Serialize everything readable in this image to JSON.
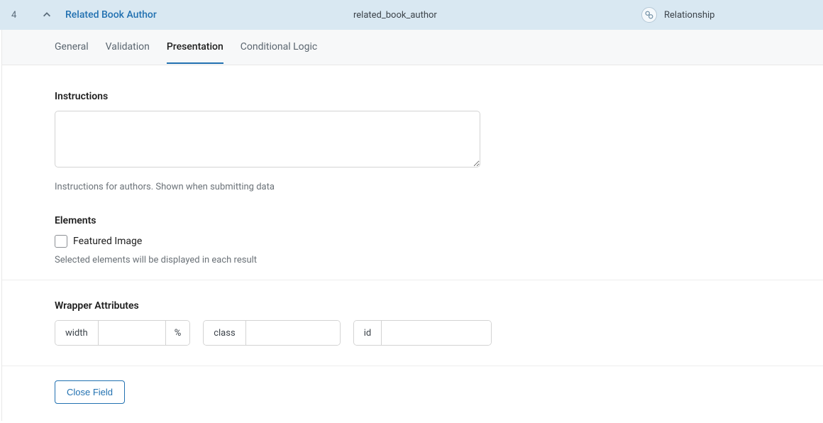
{
  "header": {
    "number": "4",
    "title": "Related Book Author",
    "slug": "related_book_author",
    "type": "Relationship"
  },
  "tabs": {
    "general": "General",
    "validation": "Validation",
    "presentation": "Presentation",
    "conditional": "Conditional Logic"
  },
  "instructions": {
    "label": "Instructions",
    "value": "",
    "help": "Instructions for authors. Shown when submitting data"
  },
  "elements": {
    "label": "Elements",
    "featured_image": "Featured Image",
    "help": "Selected elements will be displayed in each result"
  },
  "wrapper": {
    "label": "Wrapper Attributes",
    "width_label": "width",
    "width_value": "",
    "width_suffix": "%",
    "class_label": "class",
    "class_value": "",
    "id_label": "id",
    "id_value": ""
  },
  "footer": {
    "close": "Close Field"
  }
}
